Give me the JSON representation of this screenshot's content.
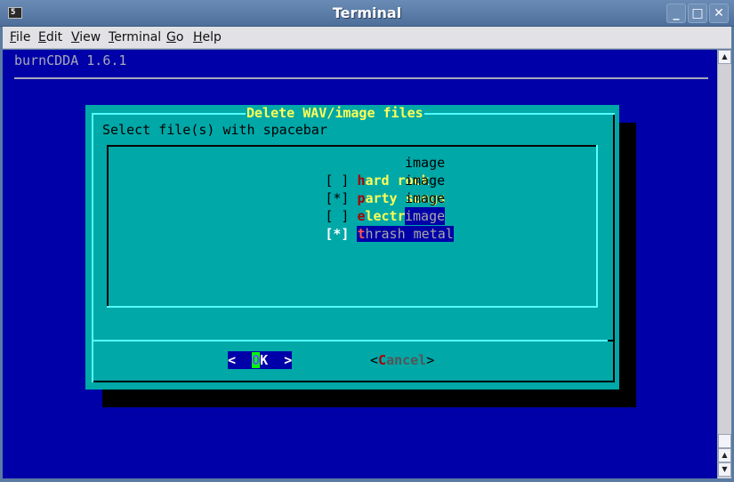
{
  "window": {
    "title": "Terminal",
    "app_icon": "terminal-app-icon",
    "controls": {
      "minimize": "_",
      "maximize": "□",
      "close": "✕"
    }
  },
  "menubar": {
    "items": [
      {
        "label": "File",
        "mnemonic": "F",
        "rest": "ile"
      },
      {
        "label": "Edit",
        "mnemonic": "E",
        "rest": "dit"
      },
      {
        "label": "View",
        "mnemonic": "V",
        "rest": "iew"
      },
      {
        "label": "Terminal",
        "mnemonic": "T",
        "rest": "erminal"
      },
      {
        "label": "Go",
        "mnemonic": "G",
        "rest": "o"
      },
      {
        "label": "Help",
        "mnemonic": "H",
        "rest": "elp"
      }
    ]
  },
  "terminal": {
    "app_title": "burnCDDA 1.6.1",
    "colors": {
      "background": "#0000a8",
      "dialog": "#00a8a8",
      "highlight": "#ffff55",
      "hotkey": "#a80000"
    },
    "dialog": {
      "title": "Delete WAV/image files",
      "prompt": "Select file(s) with spacebar",
      "items": [
        {
          "checkbox": "[ ]",
          "hotkey": "h",
          "name_rest": "ard rock",
          "type": "image",
          "checked": false,
          "selected": false
        },
        {
          "checkbox": "[*]",
          "hotkey": "p",
          "name_rest": "arty songs",
          "type": "image",
          "checked": true,
          "selected": false
        },
        {
          "checkbox": "[ ]",
          "hotkey": "e",
          "name_rest": "lectronic",
          "type": "image",
          "checked": false,
          "selected": false
        },
        {
          "checkbox": "[*]",
          "hotkey": "t",
          "name_rest": "hrash metal",
          "type": "image",
          "checked": true,
          "selected": true
        }
      ],
      "buttons": {
        "ok": {
          "left": "<  ",
          "hotkey": "O",
          "rest": "K  >"
        },
        "cancel": {
          "left": "<",
          "hotkey": "C",
          "rest": "ancel",
          "right": ">"
        }
      }
    }
  },
  "scrollbar": {
    "up_arrow": "▲",
    "down_arrow": "▼"
  }
}
